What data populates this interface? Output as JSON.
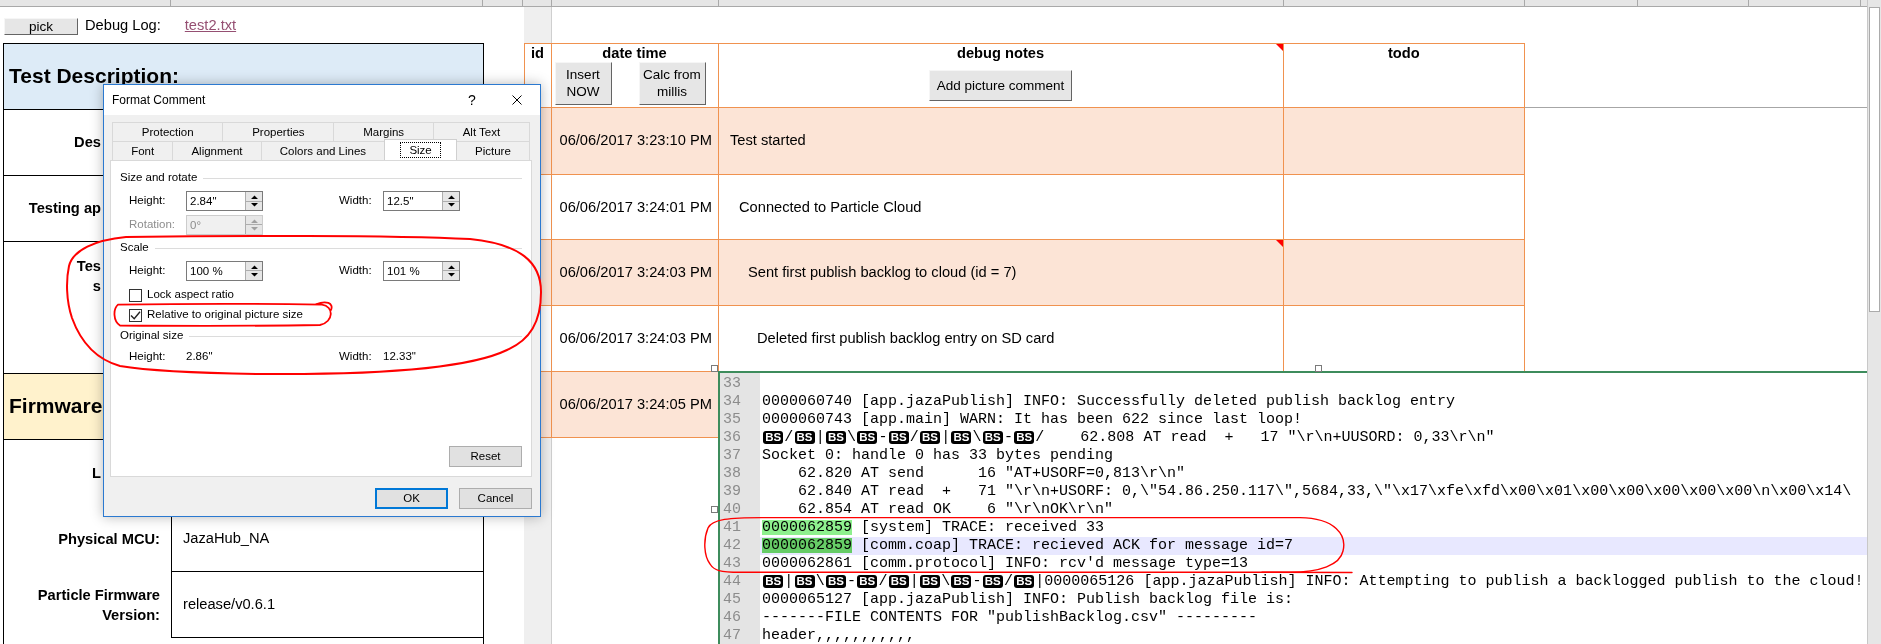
{
  "toolbar": {
    "pick_button": "pick",
    "debug_log_label": "Debug Log:",
    "debug_log_file": "test2.txt"
  },
  "test_sheet": {
    "sections": [
      {
        "title": "Test Description:",
        "color": "#ddebf7",
        "rows": [
          {
            "label": "Des"
          },
          {
            "label": "Testing ap"
          },
          {
            "label": "Tes\ns"
          }
        ]
      },
      {
        "title": "Firmware",
        "color": "#fff2cc",
        "rows": [
          {
            "label": "L"
          },
          {
            "label": "Physical MCU:",
            "value": "JazaHub_NA"
          },
          {
            "label": "Particle Firmware Version:",
            "value": "release/v0.6.1"
          }
        ]
      }
    ]
  },
  "debug_table": {
    "columns": [
      {
        "label": "id",
        "has_comment": false
      },
      {
        "label": "date time",
        "has_comment": false,
        "buttons": [
          "Insert NOW",
          "Calc from millis"
        ]
      },
      {
        "label": "debug notes",
        "has_comment": true,
        "buttons": [
          "Add picture comment"
        ]
      },
      {
        "label": "todo",
        "has_comment": false
      }
    ],
    "rows": [
      {
        "date_time": "06/06/2017 3:23:10 PM",
        "note": "Test started",
        "has_comment": false
      },
      {
        "date_time": "06/06/2017 3:24:01 PM",
        "note": "Connected to Particle Cloud",
        "has_comment": false
      },
      {
        "date_time": "06/06/2017 3:24:03 PM",
        "note": "Sent first publish backlog to cloud (id = 7)",
        "has_comment": true
      },
      {
        "date_time": "06/06/2017 3:24:03 PM",
        "note": "Deleted first publish backlog entry on SD card",
        "has_comment": false
      },
      {
        "date_time": "06/06/2017 3:24:05 PM"
      }
    ]
  },
  "dialog": {
    "title": "Format Comment",
    "help_button": "?",
    "tab_rows": [
      [
        {
          "label": "Protection",
          "selected": false
        },
        {
          "label": "Properties",
          "selected": false
        },
        {
          "label": "Margins",
          "selected": false
        },
        {
          "label": "Alt Text",
          "selected": false
        }
      ],
      [
        {
          "label": "Font",
          "selected": false
        },
        {
          "label": "Alignment",
          "selected": false
        },
        {
          "label": "Colors and Lines",
          "selected": false
        },
        {
          "label": "Size",
          "selected": true
        },
        {
          "label": "Picture",
          "selected": false
        }
      ]
    ],
    "groups": [
      {
        "title": "Size and rotate",
        "rows": [
          {
            "kind": "spinners",
            "fields": [
              {
                "label": "Height:",
                "value": "2.84\"",
                "disabled": false
              },
              {
                "label": "Width:",
                "value": "12.5\"",
                "disabled": false
              }
            ]
          },
          {
            "kind": "spinners",
            "fields": [
              {
                "label": "Rotation:",
                "value": "0°",
                "disabled": true
              }
            ]
          }
        ]
      },
      {
        "title": "Scale",
        "rows": [
          {
            "kind": "spinners",
            "fields": [
              {
                "label": "Height:",
                "value": "100 %",
                "disabled": false
              },
              {
                "label": "Width:",
                "value": "101 %",
                "disabled": false
              }
            ]
          },
          {
            "kind": "checkbox",
            "label": "Lock aspect ratio",
            "checked": false
          },
          {
            "kind": "checkbox",
            "label": "Relative to original picture size",
            "checked": true
          }
        ]
      },
      {
        "title": "Original size",
        "rows": [
          {
            "kind": "readout",
            "fields": [
              {
                "label": "Height:",
                "value": "2.86\""
              },
              {
                "label": "Width:",
                "value": "12.33\""
              }
            ]
          }
        ]
      }
    ],
    "reset_button": "Reset",
    "buttons": [
      {
        "label": "OK",
        "default": true
      },
      {
        "label": "Cancel",
        "default": false
      }
    ]
  },
  "log_viewer": {
    "lines": [
      {
        "number": "33",
        "current": false
      },
      {
        "number": "34",
        "current": false,
        "segments": [
          {
            "kind": "plain",
            "text": "0000060740 [app.jazaPublish] INFO: Successfully deleted publish backlog entry"
          }
        ]
      },
      {
        "number": "35",
        "current": false,
        "segments": [
          {
            "kind": "plain",
            "text": "0000060743 [app.main] WARN: It has been 622 since last loop!"
          }
        ]
      },
      {
        "number": "36",
        "current": false,
        "segments": [
          {
            "kind": "control",
            "text": "BS"
          },
          {
            "kind": "plain",
            "text": "/"
          },
          {
            "kind": "control",
            "text": "BS"
          },
          {
            "kind": "plain",
            "text": "|"
          },
          {
            "kind": "control",
            "text": "BS"
          },
          {
            "kind": "plain",
            "text": "\\"
          },
          {
            "kind": "control",
            "text": "BS"
          },
          {
            "kind": "plain",
            "text": "-"
          },
          {
            "kind": "control",
            "text": "BS"
          },
          {
            "kind": "plain",
            "text": "/"
          },
          {
            "kind": "control",
            "text": "BS"
          },
          {
            "kind": "plain",
            "text": "|"
          },
          {
            "kind": "control",
            "text": "BS"
          },
          {
            "kind": "plain",
            "text": "\\"
          },
          {
            "kind": "control",
            "text": "BS"
          },
          {
            "kind": "plain",
            "text": "-"
          },
          {
            "kind": "control",
            "text": "BS"
          },
          {
            "kind": "plain",
            "text": "/    62.808 AT read  +   17 \"\\r\\n+UUSORD: 0,33\\r\\n\""
          }
        ]
      },
      {
        "number": "37",
        "current": false,
        "segments": [
          {
            "kind": "plain",
            "text": "Socket 0: handle 0 has 33 bytes pending"
          }
        ]
      },
      {
        "number": "38",
        "current": false,
        "segments": [
          {
            "kind": "plain",
            "text": "    62.820 AT send      16 \"AT+USORF=0,813\\r\\n\""
          }
        ]
      },
      {
        "number": "39",
        "current": false,
        "segments": [
          {
            "kind": "plain",
            "text": "    62.840 AT read  +   71 \"\\r\\n+USORF: 0,\\\"54.86.250.117\\\",5684,33,\\\"\\x17\\xfe\\xfd\\x00\\x01\\x00\\x00\\x00\\x00\\x00\\n\\x00\\x14\\"
          }
        ]
      },
      {
        "number": "40",
        "current": false,
        "segments": [
          {
            "kind": "plain",
            "text": "    62.854 AT read OK    6 \"\\r\\nOK\\r\\n\""
          }
        ]
      },
      {
        "number": "41",
        "current": false,
        "segments": [
          {
            "kind": "match",
            "text": "0000062859"
          },
          {
            "kind": "plain",
            "text": " [system] TRACE: received 33"
          }
        ]
      },
      {
        "number": "42",
        "current": true,
        "segments": [
          {
            "kind": "match",
            "text": "0000062859"
          },
          {
            "kind": "plain",
            "text": " [comm.coap] TRACE: recieved ACK for message id=7"
          }
        ]
      },
      {
        "number": "43",
        "current": false,
        "segments": [
          {
            "kind": "plain",
            "text": "0000062861 [comm.protocol] INFO: rcv'd message type=13"
          }
        ]
      },
      {
        "number": "44",
        "current": false,
        "segments": [
          {
            "kind": "control",
            "text": "BS"
          },
          {
            "kind": "plain",
            "text": "|"
          },
          {
            "kind": "control",
            "text": "BS"
          },
          {
            "kind": "plain",
            "text": "\\"
          },
          {
            "kind": "control",
            "text": "BS"
          },
          {
            "kind": "plain",
            "text": "-"
          },
          {
            "kind": "control",
            "text": "BS"
          },
          {
            "kind": "plain",
            "text": "/"
          },
          {
            "kind": "control",
            "text": "BS"
          },
          {
            "kind": "plain",
            "text": "|"
          },
          {
            "kind": "control",
            "text": "BS"
          },
          {
            "kind": "plain",
            "text": "\\"
          },
          {
            "kind": "control",
            "text": "BS"
          },
          {
            "kind": "plain",
            "text": "-"
          },
          {
            "kind": "control",
            "text": "BS"
          },
          {
            "kind": "plain",
            "text": "/"
          },
          {
            "kind": "control",
            "text": "BS"
          },
          {
            "kind": "plain",
            "text": "|0000065126 [app.jazaPublish] INFO: Attempting to publish a backlogged publish to the cloud!"
          }
        ]
      },
      {
        "number": "45",
        "current": false,
        "segments": [
          {
            "kind": "plain",
            "text": "0000065127 [app.jazaPublish] INFO: Publish backlog file is:"
          }
        ]
      },
      {
        "number": "46",
        "current": false,
        "segments": [
          {
            "kind": "plain",
            "text": "-------FILE CONTENTS FOR \"publishBacklog.csv\" ---------"
          }
        ]
      },
      {
        "number": "47",
        "current": false,
        "segments": [
          {
            "kind": "plain",
            "text": "header,,,,,,,,,,,"
          }
        ]
      }
    ]
  }
}
